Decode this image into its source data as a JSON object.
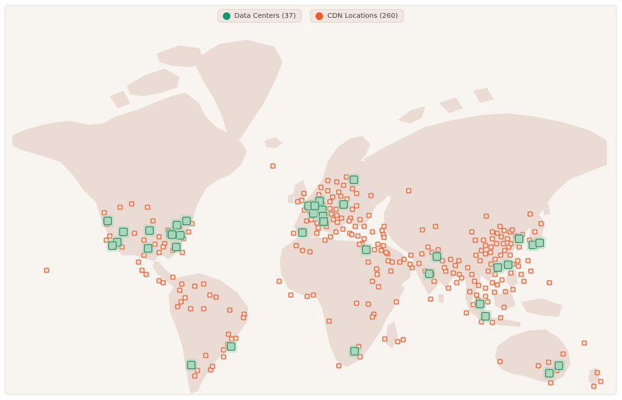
{
  "legend": {
    "data_centers": {
      "label": "Data Centers (37)",
      "color": "#0e9a6e"
    },
    "cdn": {
      "label": "CDN Locations (260)",
      "color": "#f15a24"
    }
  },
  "colors": {
    "background": "#f8f4f0",
    "land": "#eadcd4",
    "dc_fill": "#a8d8bd",
    "dc_stroke": "#3a8a5f",
    "cdn_fill": "#fbe2d8",
    "cdn_stroke": "#ef5a2a"
  },
  "map": {
    "data_center_count": 37,
    "cdn_location_count": 260
  }
}
